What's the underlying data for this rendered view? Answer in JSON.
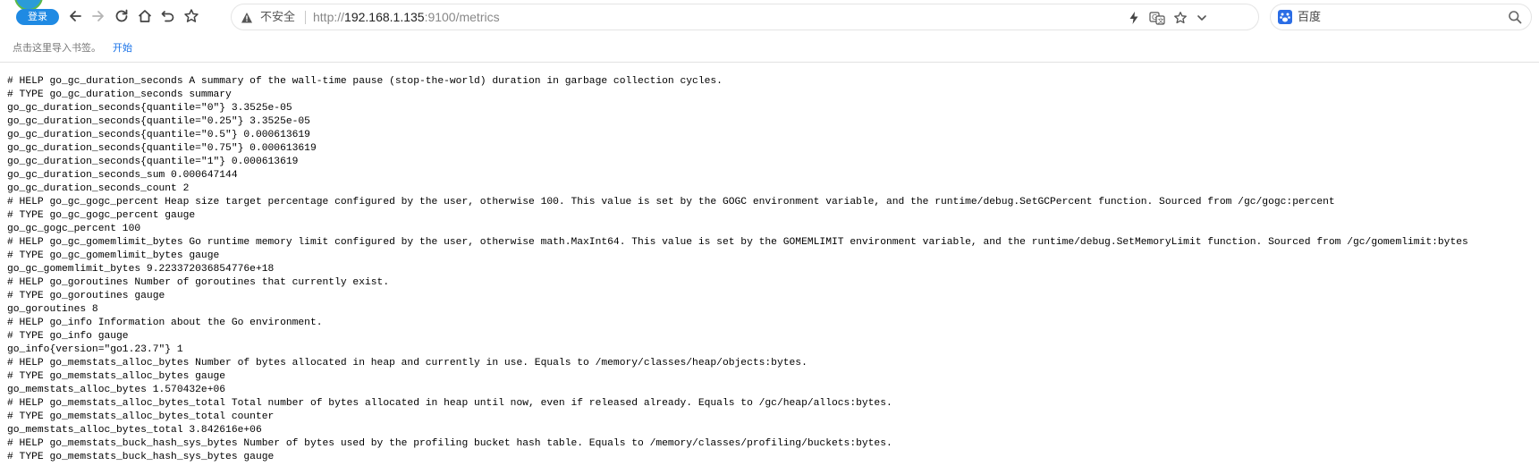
{
  "toolbar": {
    "login_label": "登录",
    "back_icon": "arrow-left-icon",
    "forward_icon": "arrow-right-icon",
    "reload_icon": "reload-icon",
    "home_icon": "home-icon",
    "undo_icon": "undo-icon",
    "star_icon": "star-icon"
  },
  "address_bar": {
    "security_label": "不安全",
    "url_scheme": "http://",
    "url_host": "192.168.1.135",
    "url_port_path": ":9100/metrics",
    "warning_icon": "warning-triangle-icon",
    "right_icons": [
      "lightning-icon",
      "translate-icon",
      "bookmark-star-icon",
      "chevron-down-icon"
    ]
  },
  "search_box": {
    "engine": "百度",
    "engine_icon": "paw-icon",
    "search_icon": "magnifier-icon"
  },
  "bookmarks_bar": {
    "hint": "点击这里导入书签。",
    "start_link": "开始"
  },
  "colors": {
    "accent": "#1f8ae3",
    "link": "#1a73e8",
    "text": "#000000"
  },
  "content": {
    "lines": [
      "# HELP go_gc_duration_seconds A summary of the wall-time pause (stop-the-world) duration in garbage collection cycles.",
      "# TYPE go_gc_duration_seconds summary",
      "go_gc_duration_seconds{quantile=\"0\"} 3.3525e-05",
      "go_gc_duration_seconds{quantile=\"0.25\"} 3.3525e-05",
      "go_gc_duration_seconds{quantile=\"0.5\"} 0.000613619",
      "go_gc_duration_seconds{quantile=\"0.75\"} 0.000613619",
      "go_gc_duration_seconds{quantile=\"1\"} 0.000613619",
      "go_gc_duration_seconds_sum 0.000647144",
      "go_gc_duration_seconds_count 2",
      "# HELP go_gc_gogc_percent Heap size target percentage configured by the user, otherwise 100. This value is set by the GOGC environment variable, and the runtime/debug.SetGCPercent function. Sourced from /gc/gogc:percent",
      "# TYPE go_gc_gogc_percent gauge",
      "go_gc_gogc_percent 100",
      "# HELP go_gc_gomemlimit_bytes Go runtime memory limit configured by the user, otherwise math.MaxInt64. This value is set by the GOMEMLIMIT environment variable, and the runtime/debug.SetMemoryLimit function. Sourced from /gc/gomemlimit:bytes",
      "# TYPE go_gc_gomemlimit_bytes gauge",
      "go_gc_gomemlimit_bytes 9.223372036854776e+18",
      "# HELP go_goroutines Number of goroutines that currently exist.",
      "# TYPE go_goroutines gauge",
      "go_goroutines 8",
      "# HELP go_info Information about the Go environment.",
      "# TYPE go_info gauge",
      "go_info{version=\"go1.23.7\"} 1",
      "# HELP go_memstats_alloc_bytes Number of bytes allocated in heap and currently in use. Equals to /memory/classes/heap/objects:bytes.",
      "# TYPE go_memstats_alloc_bytes gauge",
      "go_memstats_alloc_bytes 1.570432e+06",
      "# HELP go_memstats_alloc_bytes_total Total number of bytes allocated in heap until now, even if released already. Equals to /gc/heap/allocs:bytes.",
      "# TYPE go_memstats_alloc_bytes_total counter",
      "go_memstats_alloc_bytes_total 3.842616e+06",
      "# HELP go_memstats_buck_hash_sys_bytes Number of bytes used by the profiling bucket hash table. Equals to /memory/classes/profiling/buckets:bytes.",
      "# TYPE go_memstats_buck_hash_sys_bytes gauge"
    ]
  }
}
